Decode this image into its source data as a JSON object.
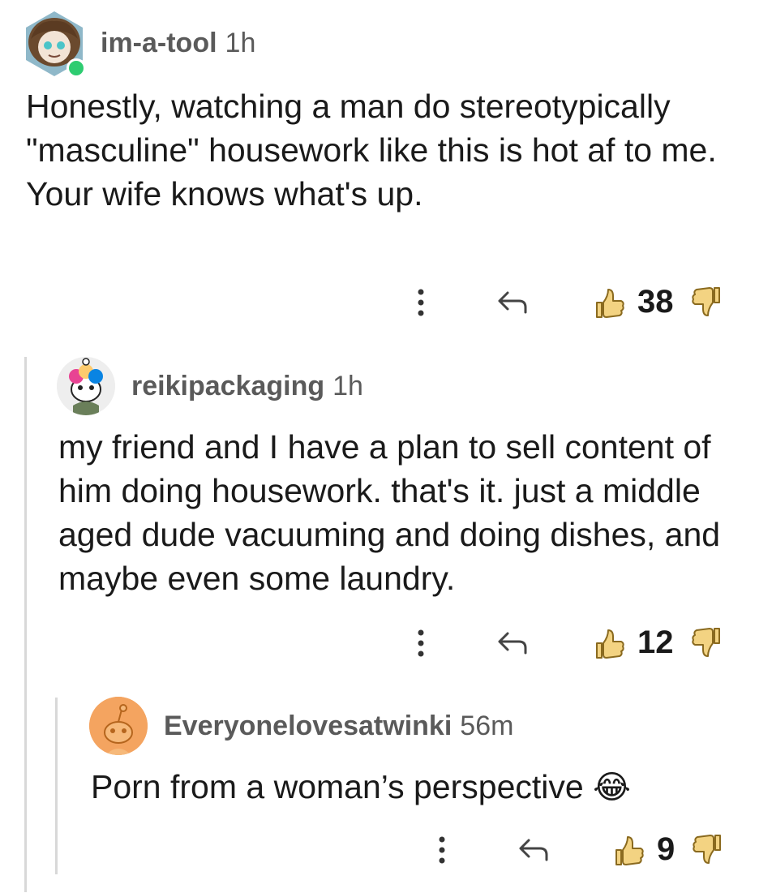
{
  "comments": [
    {
      "username": "im-a-tool",
      "time": "1h",
      "body": "Honestly, watching a man do stereotypically \"masculine\" housework like this is hot af to me. Your wife knows what's up.",
      "votes": "38",
      "avatar_icon": "anime-character-avatar-icon"
    },
    {
      "username": "reikipackaging",
      "time": "1h",
      "body": "my friend and I have a plan to sell content of him doing housework. that's it. just a middle aged dude vacuuming and doing dishes, and maybe even some laundry.",
      "votes": "12",
      "avatar_icon": "snoo-rainbow-hair-avatar-icon"
    },
    {
      "username": "Everyonelovesatwinki",
      "time": "56m",
      "body": "Porn from a woman’s perspective",
      "emoji": "😂",
      "votes": "9",
      "avatar_icon": "default-snoo-avatar-icon"
    }
  ],
  "icons": {
    "more": "more-options-icon",
    "reply": "reply-icon",
    "upvote": "thumbs-up-icon",
    "downvote": "thumbs-down-icon"
  },
  "colors": {
    "thumb_fill": "#f3d382",
    "thumb_stroke": "#8a6a1f",
    "thread_line": "#d8d8d8",
    "online_dot": "#2ecc71",
    "default_avatar_bg": "#f4a460"
  }
}
